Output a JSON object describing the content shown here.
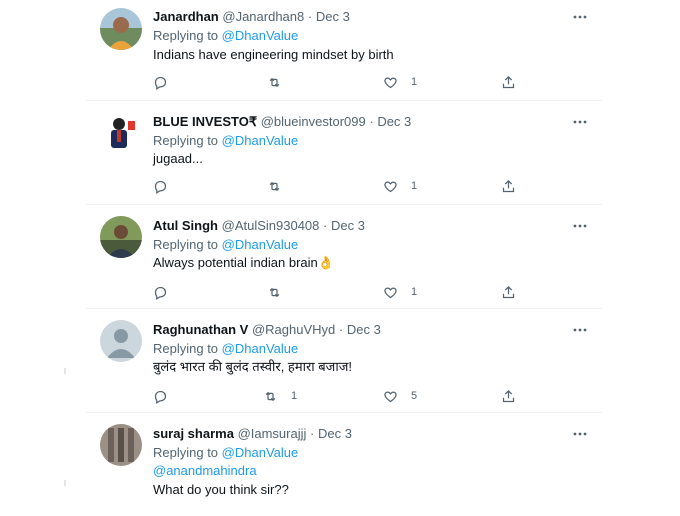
{
  "tweets": [
    {
      "name": "Janardhan",
      "handle": "@Janardhan8",
      "sep": "·",
      "date": "Dec 3",
      "replying_prefix": "Replying to",
      "replying_to": "@DhanValue",
      "mention": "",
      "text": "Indians have engineering mindset by birth",
      "reply_count": "",
      "retweet_count": "",
      "like_count": "1"
    },
    {
      "name": "BLUE INVESTO₹",
      "handle": "@blueinvestor099",
      "sep": "·",
      "date": "Dec 3",
      "replying_prefix": "Replying to",
      "replying_to": "@DhanValue",
      "mention": "",
      "text": "jugaad...",
      "reply_count": "",
      "retweet_count": "",
      "like_count": "1"
    },
    {
      "name": "Atul Singh",
      "handle": "@AtulSin930408",
      "sep": "·",
      "date": "Dec 3",
      "replying_prefix": "Replying to",
      "replying_to": "@DhanValue",
      "mention": "",
      "text": "Always potential indian brain👌",
      "reply_count": "",
      "retweet_count": "",
      "like_count": "1"
    },
    {
      "name": "Raghunathan V",
      "handle": "@RaghuVHyd",
      "sep": "·",
      "date": "Dec 3",
      "replying_prefix": "Replying to",
      "replying_to": "@DhanValue",
      "mention": "",
      "text": "बुलंद भारत की बुलंद तस्वीर, हमारा बजाज!",
      "reply_count": "",
      "retweet_count": "1",
      "like_count": "5"
    },
    {
      "name": "suraj sharma",
      "handle": "@Iamsurajjj",
      "sep": "·",
      "date": "Dec 3",
      "replying_prefix": "Replying to",
      "replying_to": "@DhanValue",
      "mention": "@anandmahindra",
      "text": "What do you think sir??",
      "reply_count": "",
      "retweet_count": "",
      "like_count": ""
    }
  ],
  "icons": {
    "reply": "reply-icon",
    "retweet": "retweet-icon",
    "like": "heart-icon",
    "share": "share-icon",
    "more": "more-icon"
  },
  "colors": {
    "link": "#1d9bf0",
    "muted": "#536471",
    "text": "#0f1419"
  }
}
